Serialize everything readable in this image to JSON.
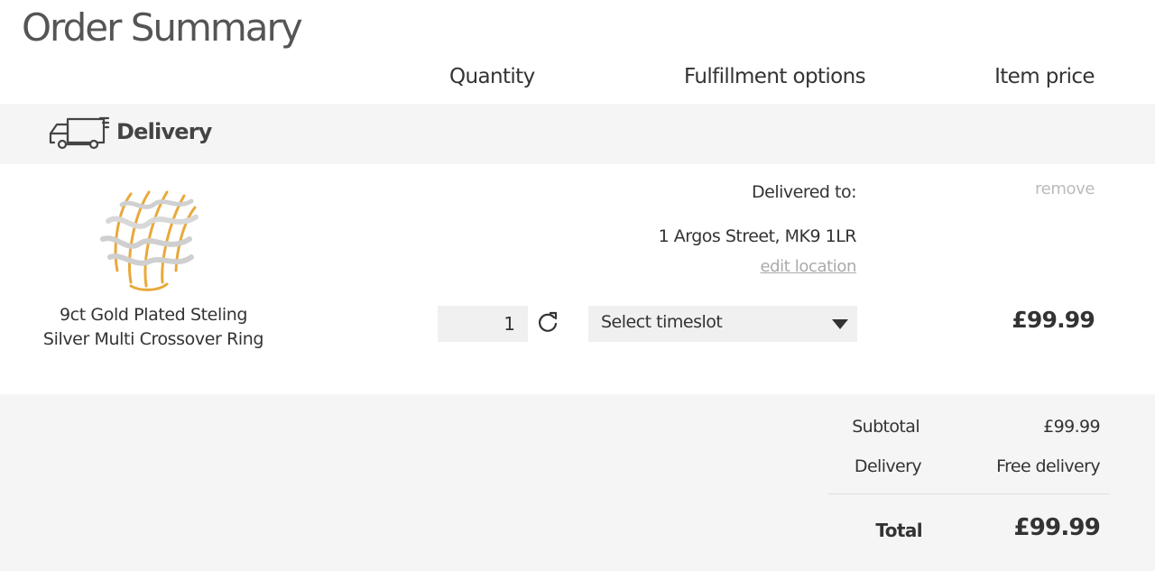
{
  "page": {
    "title": "Order Summary"
  },
  "columns": {
    "quantity": "Quantity",
    "fulfillment": "Fulfillment options",
    "item_price": "Item price"
  },
  "delivery_section": {
    "label": "Delivery",
    "icon": "truck-icon"
  },
  "item": {
    "name_line1": "9ct Gold Plated Steling",
    "name_line2": "Silver Multi Crossover Ring",
    "delivered_to_label": "Delivered to:",
    "address": "1 Argos Street, MK9 1LR",
    "edit_location": "edit location",
    "remove": "remove",
    "quantity": "1",
    "timeslot": "Select timeslot",
    "price": "£99.99"
  },
  "summary": {
    "subtotal_label": "Subtotal",
    "subtotal_value": "£99.99",
    "delivery_label": "Delivery",
    "delivery_value": "Free delivery",
    "total_label": "Total",
    "total_value": "£99.99"
  },
  "colors": {
    "band": "#f5f5f5",
    "text": "#333333",
    "muted": "#aaaaaa",
    "gold": "#e8a93b"
  }
}
